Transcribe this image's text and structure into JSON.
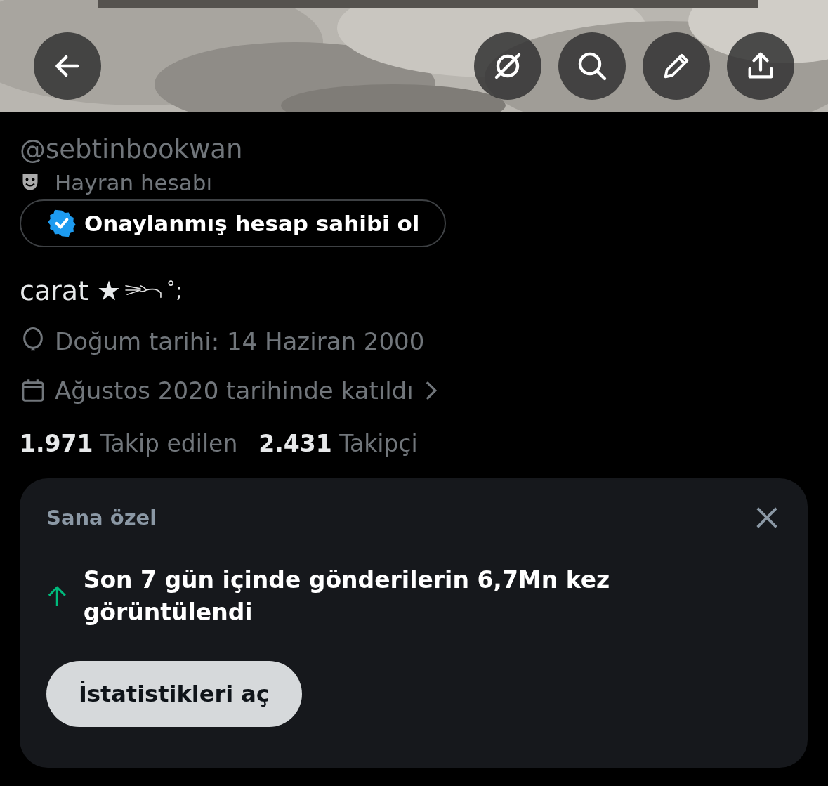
{
  "toolbar": {
    "buttons": [
      {
        "kind": "grok"
      },
      {
        "kind": "search"
      },
      {
        "kind": "edit"
      },
      {
        "kind": "share"
      }
    ]
  },
  "profile": {
    "handle": "@sebtinbookwan",
    "category": "Hayran hesabı",
    "verify_button": "Onaylanmış hesap sahibi ol",
    "bio": "carat ★",
    "bio_end": "˚;",
    "birthday": "Doğum tarihi: 14 Haziran 2000",
    "joined": "Ağustos 2020 tarihinde katıldı",
    "following_count": "1.971",
    "following_label": "Takip edilen",
    "followers_count": "2.431",
    "followers_label": "Takipçi"
  },
  "card": {
    "title": "Sana özel",
    "message": "Son 7 gün içinde gönderilerin 6,7Mn kez görüntülendi",
    "button": "İstatistikleri aç"
  }
}
